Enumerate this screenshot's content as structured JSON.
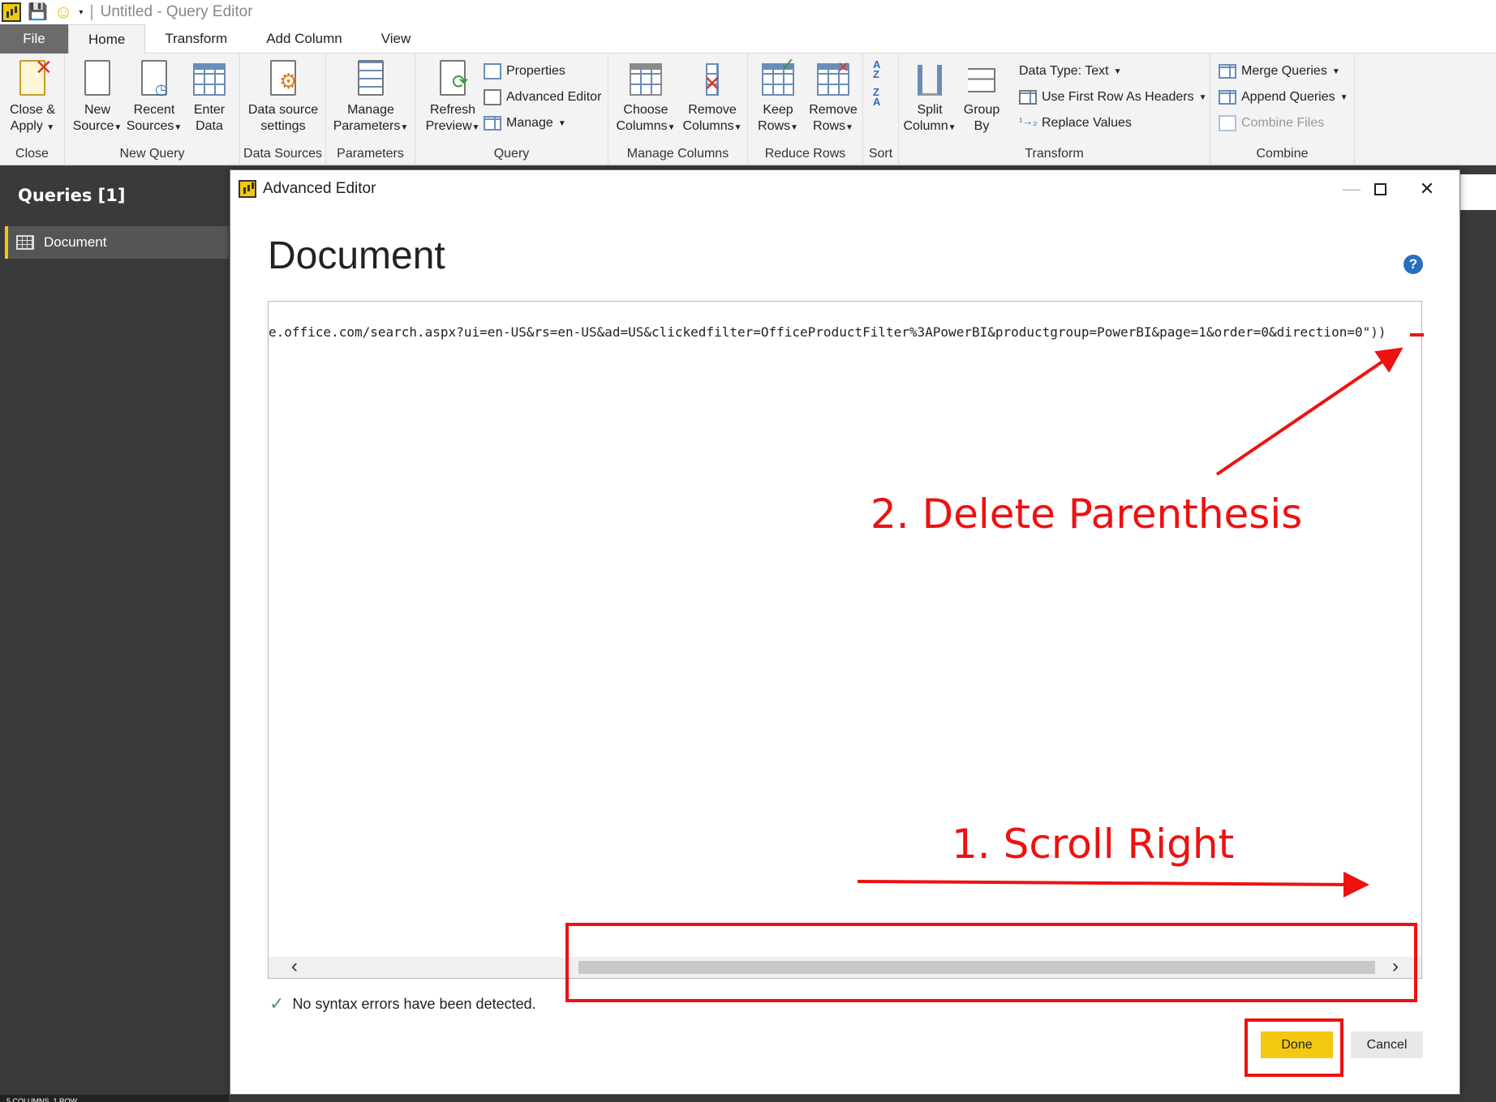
{
  "window": {
    "title": "Untitled - Query Editor",
    "separator": "|"
  },
  "tabs": [
    "File",
    "Home",
    "Transform",
    "Add Column",
    "View"
  ],
  "ribbon": {
    "close": {
      "btn_line1": "Close &",
      "btn_line2": "Apply",
      "label": "Close"
    },
    "new_query": {
      "new_line1": "New",
      "new_line2": "Source",
      "recent_line1": "Recent",
      "recent_line2": "Sources",
      "enter_line1": "Enter",
      "enter_line2": "Data",
      "label": "New Query"
    },
    "data_sources": {
      "btn_line1": "Data source",
      "btn_line2": "settings",
      "label": "Data Sources"
    },
    "parameters": {
      "btn_line1": "Manage",
      "btn_line2": "Parameters",
      "label": "Parameters"
    },
    "query": {
      "refresh_line1": "Refresh",
      "refresh_line2": "Preview",
      "properties": "Properties",
      "advanced_editor": "Advanced Editor",
      "manage": "Manage",
      "label": "Query"
    },
    "manage_columns": {
      "choose_line1": "Choose",
      "choose_line2": "Columns",
      "remove_line1": "Remove",
      "remove_line2": "Columns",
      "label": "Manage Columns"
    },
    "reduce_rows": {
      "keep_line1": "Keep",
      "keep_line2": "Rows",
      "remove_line1": "Remove",
      "remove_line2": "Rows",
      "label": "Reduce Rows"
    },
    "sort": {
      "label": "Sort"
    },
    "transform": {
      "split_line1": "Split",
      "split_line2": "Column",
      "group_line1": "Group",
      "group_line2": "By",
      "data_type": "Data Type: Text",
      "first_row": "Use First Row As Headers",
      "replace": "Replace Values",
      "label": "Transform"
    },
    "combine": {
      "merge": "Merge Queries",
      "append": "Append Queries",
      "combine_files": "Combine Files",
      "label": "Combine"
    }
  },
  "queries_pane": {
    "title": "Queries [1]",
    "items": [
      "Document"
    ],
    "status": "5 COLUMNS, 1 ROW"
  },
  "dialog": {
    "title": "Advanced Editor",
    "heading": "Document",
    "help": "?",
    "code": "e.office.com/search.aspx?ui=en-US&rs=en-US&ad=US&clickedfilter=OfficeProductFilter%3APowerBI&productgroup=PowerBI&page=1&order=0&direction=0\"))",
    "syntax_status": "No syntax errors have been detected.",
    "done": "Done",
    "cancel": "Cancel"
  },
  "annotations": {
    "step1": "1. Scroll Right",
    "step2": "2. Delete Parenthesis",
    "color": "#ee1111"
  },
  "colors": {
    "accent": "#f2c811",
    "file_tab": "#6b6b6b",
    "pane_bg": "#3a3a3a"
  }
}
